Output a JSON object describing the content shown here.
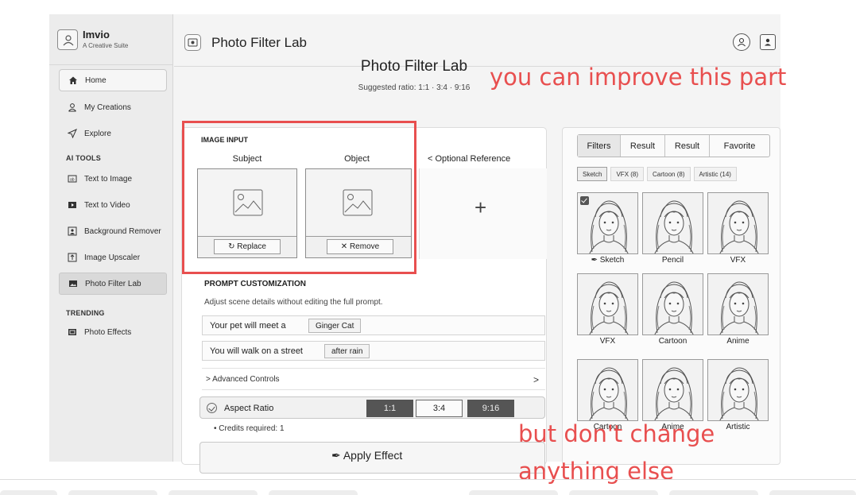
{
  "app": {
    "name": "Imvio",
    "tagline": "A Creative Suite"
  },
  "sidebar": {
    "items_top": [
      {
        "label": "Home",
        "icon": "home-icon"
      },
      {
        "label": "My Creations",
        "icon": "user-icon"
      },
      {
        "label": "Explore",
        "icon": "send-icon"
      }
    ],
    "ai_tools_heading": "AI TOOLS",
    "ai_tools": [
      {
        "label": "Text to Image",
        "icon": "text-image-icon"
      },
      {
        "label": "Text to Video",
        "icon": "video-icon"
      },
      {
        "label": "Background Remover",
        "icon": "bg-remove-icon"
      },
      {
        "label": "Image Upscaler",
        "icon": "upscale-icon"
      },
      {
        "label": "Photo Filter Lab",
        "icon": "photo-lab-icon"
      }
    ],
    "trending_heading": "TRENDING",
    "trending": [
      {
        "label": "Photo Effects",
        "icon": "photo-effects-icon"
      }
    ]
  },
  "header": {
    "title": "Photo Filter Lab"
  },
  "page": {
    "title": "Photo Filter Lab",
    "subtitle": "Suggested ratio: 1:1 · 3:4 · 9:16"
  },
  "image_input": {
    "heading": "IMAGE INPUT",
    "subject_label": "Subject",
    "object_label": "Object",
    "optional_ref_label": "< Optional Reference",
    "replace_button": "↻ Replace",
    "remove_button": "✕ Remove",
    "add_symbol": "+"
  },
  "prompt": {
    "heading": "PROMPT CUSTOMIZATION",
    "help": "Adjust scene details without editing the full prompt.",
    "rows": [
      {
        "text": "Your pet will meet a",
        "chip": "Ginger Cat"
      },
      {
        "text": "You will walk on a street",
        "chip": "after rain"
      }
    ],
    "advanced": "> Advanced Controls",
    "advanced_chevron": ">",
    "aspect_label": "Aspect Ratio",
    "ratios": [
      "1:1",
      "3:4",
      "9:16"
    ],
    "selected_ratio": "3:4",
    "credits": "• Credits required: 1",
    "apply": "✒ Apply Effect"
  },
  "filters": {
    "tabs": [
      "Filters",
      "Result",
      "Result",
      "Favorite"
    ],
    "active_tab": "Filters",
    "subtabs": [
      "Sketch",
      "VFX (8)",
      "Cartoon (8)",
      "Artistic (14)"
    ],
    "active_subtab": "Sketch",
    "thumbs": [
      {
        "label": "✒ Sketch",
        "checked": true
      },
      {
        "label": "Pencil"
      },
      {
        "label": "VFX"
      },
      {
        "label": "VFX"
      },
      {
        "label": "Cartoon"
      },
      {
        "label": "Anime"
      },
      {
        "label": "Cartoon"
      },
      {
        "label": "Anime"
      },
      {
        "label": "Artistic"
      }
    ]
  },
  "annotations": {
    "top": "you can improve this part",
    "bottom_line1": "but don't change",
    "bottom_line2": "anything else",
    "color": "#e84f4f"
  }
}
